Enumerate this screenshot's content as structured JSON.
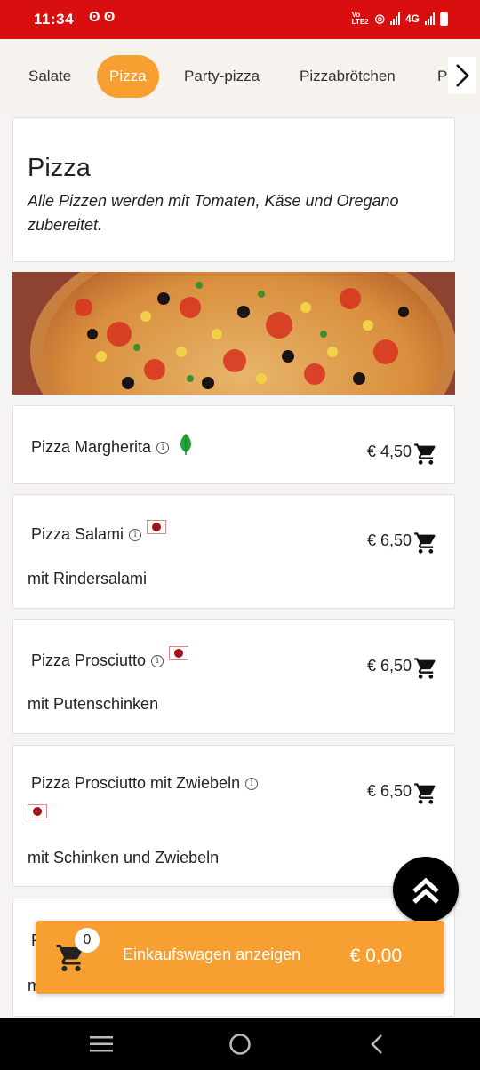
{
  "status_bar": {
    "time": "11:34",
    "notification_icons": "ʘ ʘ",
    "network_label": "Vo LTE2",
    "net_type": "4G"
  },
  "category_tabs": {
    "items": [
      {
        "label": "Salate",
        "active": false
      },
      {
        "label": "Pizza",
        "active": true
      },
      {
        "label": "Party-pizza",
        "active": false
      },
      {
        "label": "Pizzabrötchen",
        "active": false
      },
      {
        "label": "Pa",
        "active": false
      }
    ],
    "accent_color": "#f7a031"
  },
  "category": {
    "title": "Pizza",
    "description": "Alle Pizzen werden mit Tomaten, Käse und Oregano zubereitet."
  },
  "menu_items": [
    {
      "name": "Pizza Margherita",
      "price": "€ 4,50",
      "subtitle": "",
      "badge": "leaf-icon"
    },
    {
      "name": "Pizza Salami",
      "price": "€ 6,50",
      "subtitle": "mit Rindersalami",
      "badge": "halal-flag"
    },
    {
      "name": "Pizza Prosciutto",
      "price": "€ 6,50",
      "subtitle": "mit Putenschinken",
      "badge": "halal-flag"
    },
    {
      "name": "Pizza Prosciutto mit Zwiebeln",
      "price": "€ 6,50",
      "subtitle": "mit Schinken und Zwiebeln",
      "badge": "halal-flag"
    },
    {
      "name": "P",
      "price": "",
      "subtitle": "m",
      "badge": ""
    }
  ],
  "cart": {
    "count": "0",
    "label": "Einkaufswagen anzeigen",
    "total": "€ 0,00"
  },
  "colors": {
    "status_bar": "#d90f0f",
    "accent": "#f7a031",
    "veg_green": "#22a33a"
  }
}
